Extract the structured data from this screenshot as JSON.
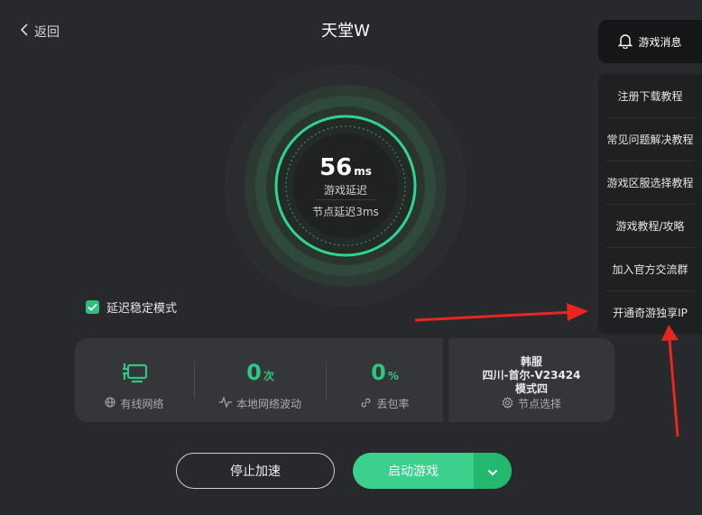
{
  "header": {
    "back_label": "返回",
    "title": "天堂W"
  },
  "gauge": {
    "latency_value": "56",
    "latency_unit": "ms",
    "latency_label": "游戏延迟",
    "node_latency": "节点延迟3ms"
  },
  "stable_mode": {
    "label": "延迟稳定模式",
    "checked": true
  },
  "stats": {
    "network": {
      "label": "有线网络"
    },
    "jitter": {
      "value": "0",
      "unit": "次",
      "label": "本地网络波动"
    },
    "packet_loss": {
      "value": "0",
      "unit": "%",
      "label": "丢包率"
    },
    "server": {
      "region": "韩服",
      "node": "四川-首尔-V23424",
      "mode": "模式四",
      "label": "节点选择"
    }
  },
  "buttons": {
    "stop": "停止加速",
    "start": "启动游戏"
  },
  "right_panel": {
    "notice": "游戏消息",
    "menu": [
      "注册下载教程",
      "常见问题解决教程",
      "游戏区服选择教程",
      "游戏教程/攻略",
      "加入官方交流群",
      "开通奇游独享IP"
    ]
  },
  "colors": {
    "accent": "#2dc77f",
    "background": "#27292c",
    "panel": "#343639",
    "arrow": "#e8261f"
  }
}
